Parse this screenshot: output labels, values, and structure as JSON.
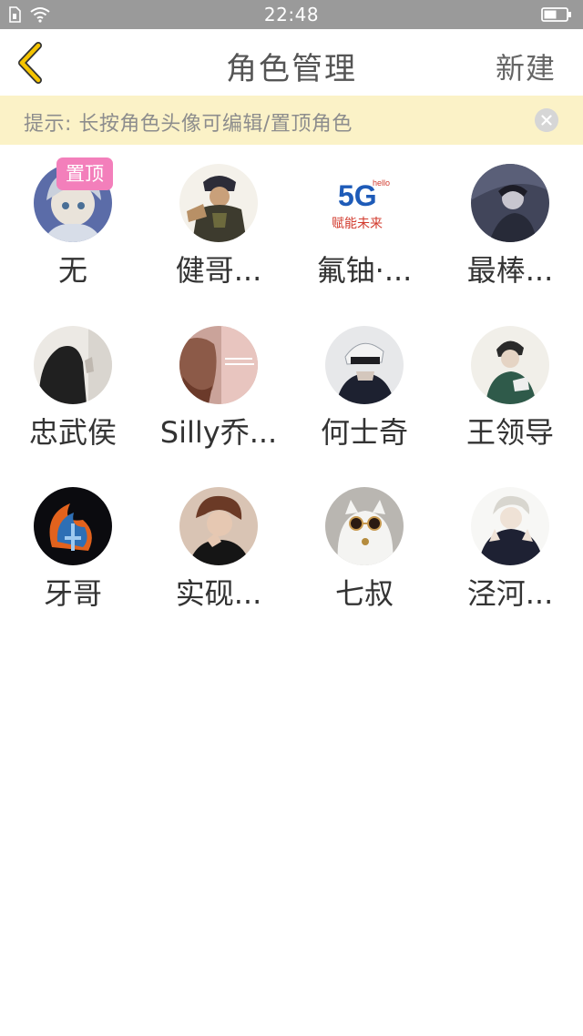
{
  "status_bar": {
    "time": "22:48",
    "icons": [
      "sim-icon",
      "wifi-icon",
      "battery-icon"
    ]
  },
  "nav": {
    "title": "角色管理",
    "new_label": "新建",
    "back_icon": "chevron-left-icon",
    "accent_color": "#f5c400"
  },
  "hint": {
    "text": "提示: 长按角色头像可编辑/置顶角色",
    "close_icon": "close-icon",
    "background": "#fbf2c7"
  },
  "pin_badge": "置顶",
  "characters": [
    {
      "name": "无",
      "pinned": true
    },
    {
      "name": "健哥..."
    },
    {
      "name": "氟铀·..."
    },
    {
      "name": "最棒..."
    },
    {
      "name": "忠武侯"
    },
    {
      "name": "Silly乔..."
    },
    {
      "name": "何士奇"
    },
    {
      "name": "王领导"
    },
    {
      "name": "牙哥"
    },
    {
      "name": "实砚..."
    },
    {
      "name": "七叔"
    },
    {
      "name": "泾河..."
    }
  ],
  "avatar_5g": {
    "big": "5G",
    "small": "hello",
    "caption": "赋能未来"
  }
}
